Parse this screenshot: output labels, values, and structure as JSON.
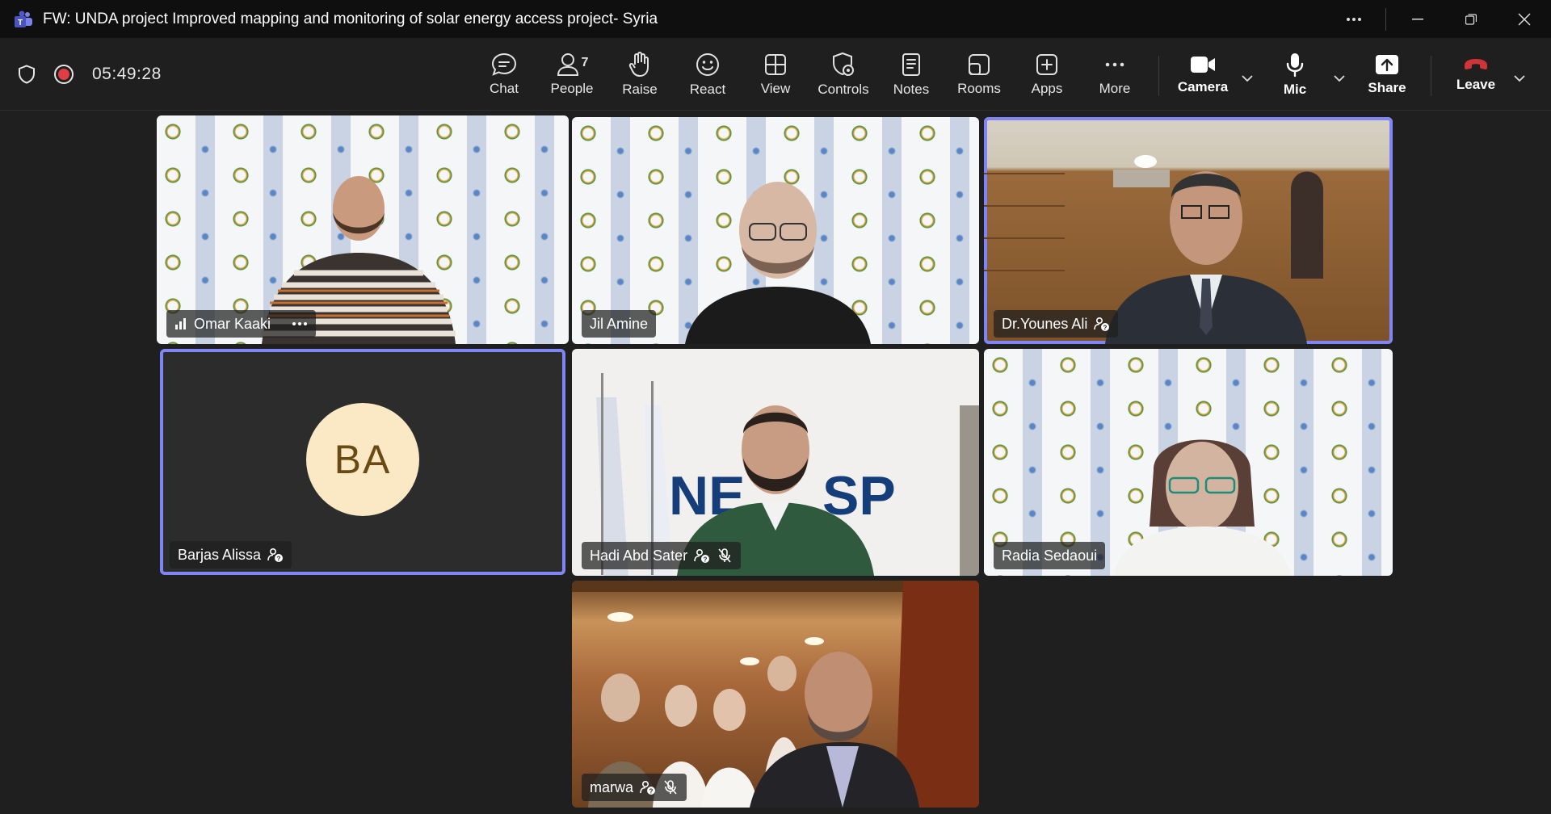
{
  "window": {
    "title": "FW: UNDA project Improved mapping and monitoring of solar energy access project- Syria"
  },
  "meeting": {
    "timer": "05:49:28"
  },
  "toolbar": {
    "chat": "Chat",
    "people": "People",
    "people_count": "7",
    "raise": "Raise",
    "react": "React",
    "view": "View",
    "controls": "Controls",
    "notes": "Notes",
    "rooms": "Rooms",
    "apps": "Apps",
    "more": "More",
    "camera": "Camera",
    "mic": "Mic",
    "share": "Share",
    "leave": "Leave"
  },
  "participants": [
    {
      "name": "Omar Kaaki"
    },
    {
      "name": "Jil Amine"
    },
    {
      "name": "Dr.Younes Ali"
    },
    {
      "name": "Barjas Alissa",
      "initials": "BA"
    },
    {
      "name": "Hadi Abd Sater"
    },
    {
      "name": "Radia Sedaoui"
    },
    {
      "name": "marwa"
    }
  ],
  "colors": {
    "accent": "#7f85f5",
    "leave_red": "#d13438",
    "background": "#1f1f1f"
  }
}
